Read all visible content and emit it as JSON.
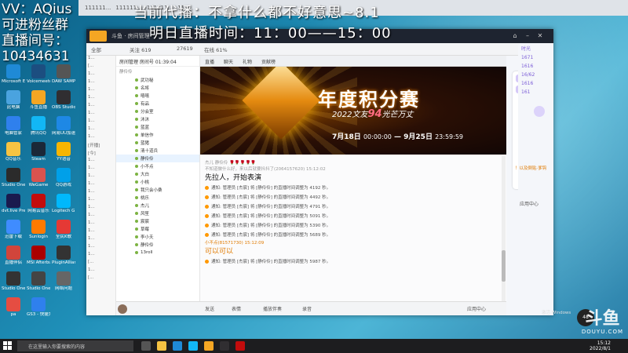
{
  "overlay": {
    "left_lines": [
      "VV：AQius",
      "可进粉丝群",
      "直播间号：",
      "10434631"
    ],
    "top_line1": "当前代播：不拿什么都不好意思~8.1",
    "top_line2": "明日直播时间：11：00——15：00"
  },
  "tabstrip": [
    "111111...",
    "111111...",
    "111111...",
    "11..."
  ],
  "desktop_icons": [
    {
      "label": "Microsoft Edge",
      "color": "#1f8ad6"
    },
    {
      "label": "此电脑",
      "color": "#4aa3df"
    },
    {
      "label": "电脑管家",
      "color": "#2f80ed"
    },
    {
      "label": "QQ音乐",
      "color": "#f6c342"
    },
    {
      "label": "Studio One",
      "color": "#2b2b2b"
    },
    {
      "label": "dvt.live Premiere",
      "color": "#1a1a4e"
    },
    {
      "label": "迅雷下载",
      "color": "#3f8cff"
    },
    {
      "label": "直播伴侣",
      "color": "#d1453b"
    },
    {
      "label": "Studio One",
      "color": "#333"
    },
    {
      "label": "pa",
      "color": "#e54d42"
    },
    {
      "label": "Voicemeeter Banana",
      "color": "#1c4e80"
    },
    {
      "label": "斗鱼直播",
      "color": "#f5a623"
    },
    {
      "label": "腾讯QQ",
      "color": "#12b7f5"
    },
    {
      "label": "Steam",
      "color": "#1b2838"
    },
    {
      "label": "WeGame",
      "color": "#d9534f"
    },
    {
      "label": "网易云音乐",
      "color": "#c20c0c"
    },
    {
      "label": "Sunlogin",
      "color": "#ff7a00"
    },
    {
      "label": "MSI Afterburner",
      "color": "#a00"
    },
    {
      "label": "Studio One",
      "color": "#444"
    },
    {
      "label": "GS3 - 快捷方式",
      "color": "#2f80ed"
    },
    {
      "label": "DAW SAMPLE",
      "color": "#555"
    },
    {
      "label": "OBS Studio",
      "color": "#302e31"
    },
    {
      "label": "网易UU加速器",
      "color": "#1e88e5"
    },
    {
      "label": "YY语音",
      "color": "#f7b500"
    },
    {
      "label": "QQ游戏",
      "color": "#00a0e9"
    },
    {
      "label": "Logitech G HUB",
      "color": "#00b8fc"
    },
    {
      "label": "全民K歌",
      "color": "#e53935"
    },
    {
      "label": "PluginAlliance",
      "color": "#333"
    },
    {
      "label": "网络问题",
      "color": "#666"
    }
  ],
  "app": {
    "title": "斗鱼 · 房间管理",
    "toolbar": [
      "全部",
      "关注 619",
      "27619",
      "在线 61%"
    ],
    "leftcol_rows": [
      "1...",
      "[...",
      "1...",
      "1...",
      "1...",
      "1...",
      "1...",
      "1...",
      "1...",
      "1...",
      "1...",
      "[开播]",
      "[今]",
      "1...",
      "1...",
      "1...",
      "1...",
      "1...",
      "1...",
      "1...",
      "1...",
      "1...",
      "1...",
      "1...",
      "1...",
      "1...",
      "[...",
      "1...",
      "[..."
    ],
    "room_header": "房间管理 房间号 01:39:04",
    "room_sub": "静伶伶",
    "room_items": [
      "武功秘",
      "名将",
      "嘻嘻",
      "有品",
      "分会室",
      "沐沐",
      "蓝蓝",
      "单信作",
      "蓝猪",
      "清十道兵",
      "静伶伶",
      "小不点",
      "大白",
      "小桃",
      "我只会小桑",
      "桃乐",
      "杰儿",
      "风笙",
      "宸宸",
      "草莓",
      "李小夭",
      "静伶伶",
      "13roll"
    ],
    "selected_index": 10,
    "banner": {
      "title": "年度积分赛",
      "sub_prefix": "2022文友",
      "sub_highlight": "94",
      "sub_suffix": "光芒万丈",
      "date_start": "7月18日",
      "time_start": "00:00:00",
      "date_end": "9月25日",
      "time_end": "23:59:59"
    },
    "chat_topbar": [
      "直播",
      "聊天",
      "礼物",
      "贡献榜"
    ],
    "msg1_meta": "杰儿  静伶伶 🌹🌹🌹🌹🌹",
    "msg2_meta": "不知道做什么好，来以后就要抖抖了(2064157620)  15:12:02",
    "msg2_text": "先拉人，开始表演",
    "notices": [
      "通知: 管理员 [杰宸] 将 [静伶伶] 的直播时间调整为 4192 秒。",
      "通知: 管理员 [杰宸] 将 [静伶伶] 的直播时间调整为 4492 秒。",
      "通知: 管理员 [杰宸] 将 [静伶伶] 的直播时间调整为 4791 秒。",
      "通知: 管理员 [杰宸] 将 [静伶伶] 的直播时间调整为 5091 秒。",
      "通知: 管理员 [杰宸] 将 [静伶伶] 的直播时间调整为 5390 秒。",
      "通知: 管理员 [杰宸] 将 [静伶伶] 的直播时间调整为 5689 秒。"
    ],
    "msg3_meta": "小不点(81571730)  15:12:09",
    "msg3_text": "可以可以",
    "notice_last": "通知: 管理员 [杰宸] 将 [静伶伶] 的直播时间调整为 5987 秒。",
    "input_items": [
      "发送",
      "表情",
      "播放伴奏",
      "录音"
    ],
    "input_right": "应用中心"
  },
  "right_ext": {
    "nums": [
      "时光",
      "1671",
      "1616",
      "16/62",
      "1616",
      "161"
    ],
    "msg": "！以及倒贴·爹钩",
    "bottom": "应用中心"
  },
  "taskbar": {
    "search_placeholder": "在这里输入你要搜索的内容",
    "time": "15:12",
    "date": "2022/8/1"
  },
  "speed": "48",
  "activate_text": "激活 Windows",
  "watermark": {
    "big": "斗鱼",
    "small": "DOUYU.COM"
  }
}
